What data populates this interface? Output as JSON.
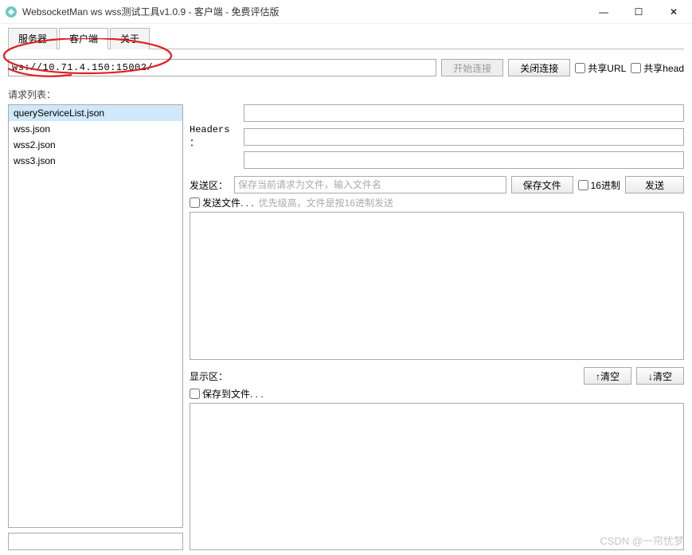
{
  "window": {
    "title": "WebsocketMan ws wss测试工具v1.0.9   - 客户端 - 免费评估版",
    "minimize": "—",
    "maximize": "☐",
    "close": "✕"
  },
  "tabs": {
    "server": "服务器",
    "client": "客户端",
    "about": "关于"
  },
  "url": {
    "value": "ws://10.71.4.150:15002/"
  },
  "buttons": {
    "start_conn": "开始连接",
    "close_conn": "关闭连接",
    "save_file": "保存文件",
    "send": "发送",
    "clear_up": "↑清空",
    "clear_down": "↓清空"
  },
  "checkboxes": {
    "share_url": "共享URL",
    "share_head": "共享head",
    "hex": "16进制",
    "send_file": "发送文件. . .",
    "save_to_file": "保存到文件. . ."
  },
  "labels": {
    "request_list": "请求列表：",
    "headers": "Headers ：",
    "send_area": "发送区：",
    "send_file_hint": "优先级高，文件是按16进制发送",
    "display_area": "显示区：",
    "send_placeholder": "保存当前请求为文件，输入文件名"
  },
  "request_list": [
    "queryServiceList.json",
    "wss.json",
    "wss2.json",
    "wss3.json"
  ],
  "watermark": "CSDN @一帘忧梦"
}
